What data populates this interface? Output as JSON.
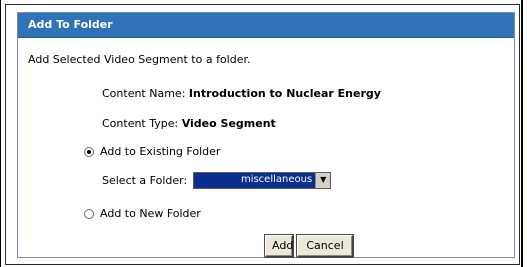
{
  "dialog": {
    "title": "Add To Folder",
    "intro": "Add Selected Video Segment to a folder.",
    "content_name_label": "Content Name:",
    "content_name_value": "Introduction to Nuclear Energy",
    "content_type_label": "Content Type:",
    "content_type_value": "Video Segment",
    "option_existing": "Add to Existing Folder",
    "option_existing_selected": true,
    "select_label": "Select a Folder:",
    "select_value": "miscellaneous",
    "option_new": "Add to New Folder",
    "add_button": "Add",
    "cancel_button": "Cancel"
  },
  "colors": {
    "title_bar": "#2f72b8",
    "select_highlight": "#0b2f8f"
  }
}
